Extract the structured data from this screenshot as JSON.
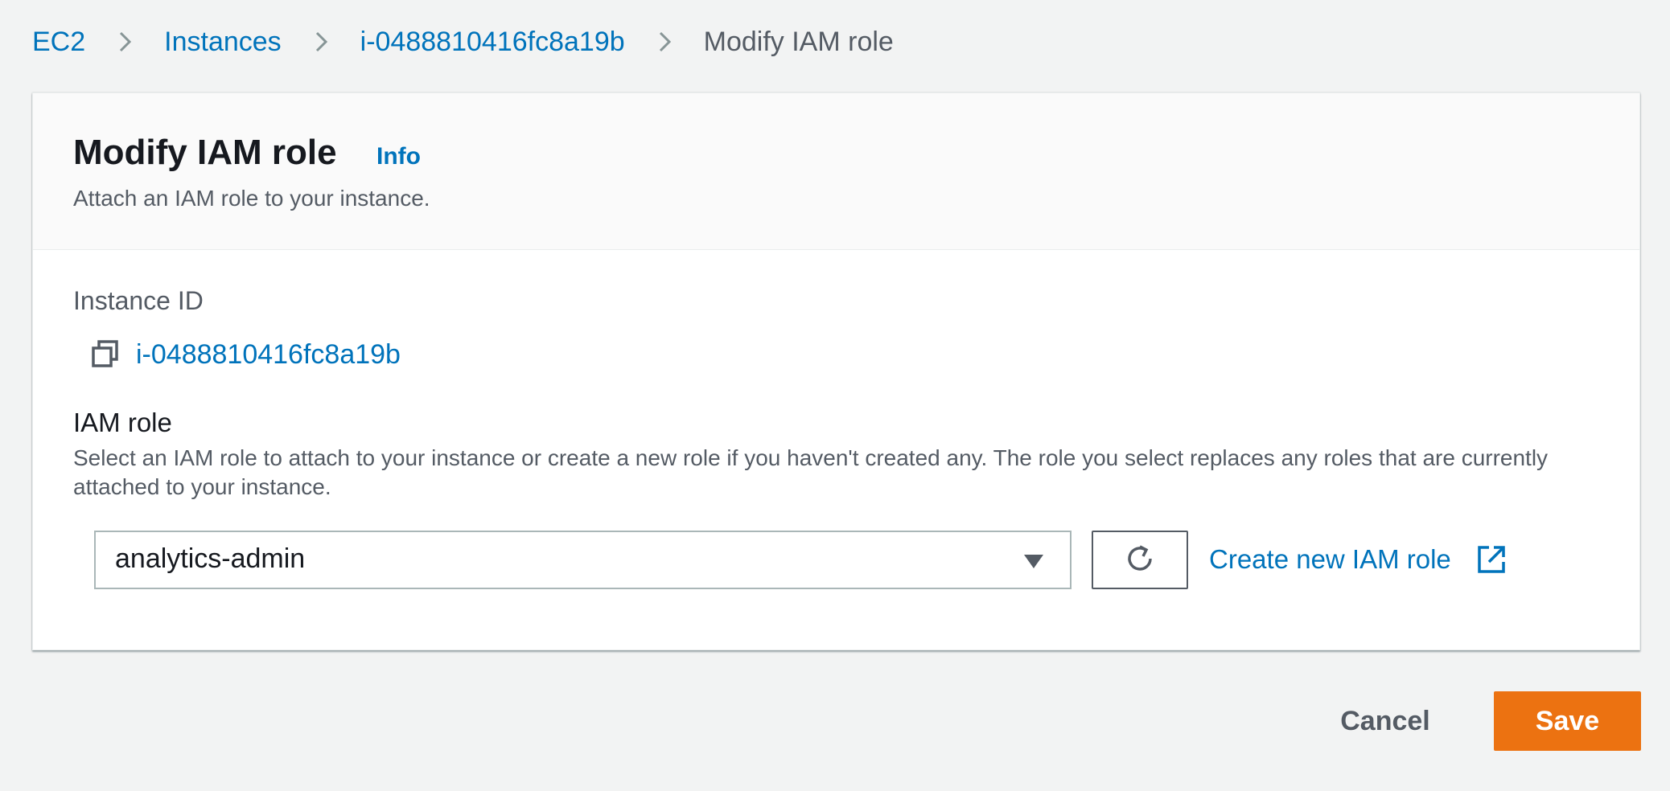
{
  "breadcrumb": {
    "items": [
      {
        "label": "EC2"
      },
      {
        "label": "Instances"
      },
      {
        "label": "i-0488810416fc8a19b"
      }
    ],
    "current": "Modify IAM role"
  },
  "panel": {
    "title": "Modify IAM role",
    "info_label": "Info",
    "description": "Attach an IAM role to your instance."
  },
  "instance": {
    "label": "Instance ID",
    "id": "i-0488810416fc8a19b"
  },
  "iam_role": {
    "label": "IAM role",
    "description": "Select an IAM role to attach to your instance or create a new role if you haven't created any. The role you select replaces any roles that are currently attached to your instance.",
    "selected": "analytics-admin",
    "create_link": "Create new IAM role"
  },
  "actions": {
    "cancel_label": "Cancel",
    "save_label": "Save"
  },
  "colors": {
    "link": "#0073bb",
    "primary_button": "#ec7211",
    "background": "#f2f3f3",
    "text_secondary": "#545b64"
  },
  "icons": {
    "breadcrumb_separator": "chevron-right-icon",
    "copy": "copy-icon",
    "select_caret": "caret-down-icon",
    "refresh": "refresh-icon",
    "external": "external-link-icon"
  }
}
